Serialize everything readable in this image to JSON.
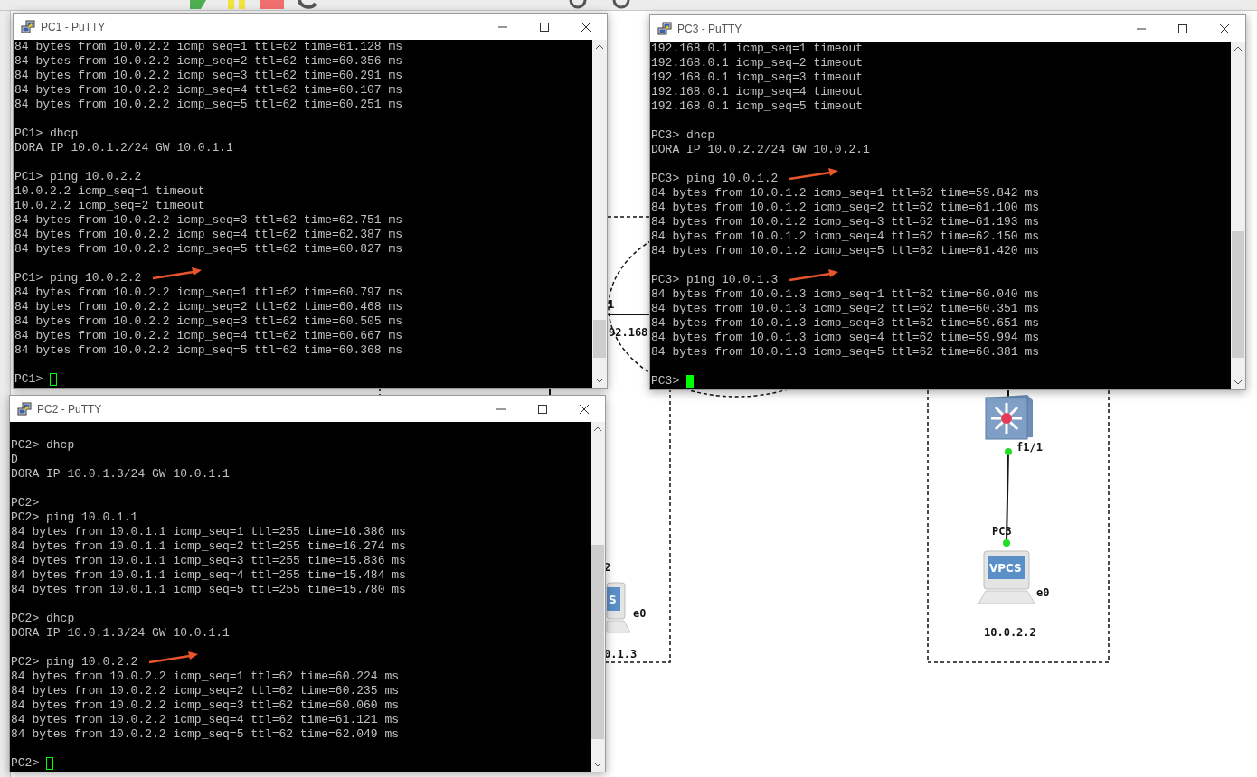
{
  "canvas": {
    "link_port": "1",
    "link_network": "92.168",
    "left_node_label": "2",
    "left_screen": "S",
    "left_port": "e0",
    "left_address": "0.1.3",
    "switch_port": "f1/1",
    "pc3_name": "PC3",
    "pc3_screen": "VPCS",
    "pc3_port": "e0",
    "pc3_address": "10.0.2.2"
  },
  "windows": [
    {
      "title": "PC1 - PuTTY",
      "prompt": "PC1>",
      "cursor_filled": false,
      "blocks": [
        {
          "arrow": false,
          "lines": [
            "84 bytes from 10.0.2.2 icmp_seq=1 ttl=62 time=61.128 ms",
            "84 bytes from 10.0.2.2 icmp_seq=2 ttl=62 time=60.356 ms",
            "84 bytes from 10.0.2.2 icmp_seq=3 ttl=62 time=60.291 ms",
            "84 bytes from 10.0.2.2 icmp_seq=4 ttl=62 time=60.107 ms",
            "84 bytes from 10.0.2.2 icmp_seq=5 ttl=62 time=60.251 ms"
          ]
        },
        {
          "arrow": false,
          "lines": [
            "PC1> dhcp",
            "DORA IP 10.0.1.2/24 GW 10.0.1.1"
          ]
        },
        {
          "arrow": false,
          "lines": [
            "PC1> ping 10.0.2.2",
            "10.0.2.2 icmp_seq=1 timeout",
            "10.0.2.2 icmp_seq=2 timeout",
            "84 bytes from 10.0.2.2 icmp_seq=3 ttl=62 time=62.751 ms",
            "84 bytes from 10.0.2.2 icmp_seq=4 ttl=62 time=62.387 ms",
            "84 bytes from 10.0.2.2 icmp_seq=5 ttl=62 time=60.827 ms"
          ]
        },
        {
          "arrow": true,
          "lines": [
            "PC1> ping 10.0.2.2",
            "84 bytes from 10.0.2.2 icmp_seq=1 ttl=62 time=60.797 ms",
            "84 bytes from 10.0.2.2 icmp_seq=2 ttl=62 time=60.468 ms",
            "84 bytes from 10.0.2.2 icmp_seq=3 ttl=62 time=60.505 ms",
            "84 bytes from 10.0.2.2 icmp_seq=4 ttl=62 time=60.667 ms",
            "84 bytes from 10.0.2.2 icmp_seq=5 ttl=62 time=60.368 ms"
          ]
        }
      ]
    },
    {
      "title": "PC3 - PuTTY",
      "prompt": "PC3>",
      "cursor_filled": true,
      "blocks": [
        {
          "arrow": false,
          "lines": [
            "192.168.0.1 icmp_seq=1 timeout",
            "192.168.0.1 icmp_seq=2 timeout",
            "192.168.0.1 icmp_seq=3 timeout",
            "192.168.0.1 icmp_seq=4 timeout",
            "192.168.0.1 icmp_seq=5 timeout"
          ]
        },
        {
          "arrow": false,
          "lines": [
            "PC3> dhcp",
            "DORA IP 10.0.2.2/24 GW 10.0.2.1"
          ]
        },
        {
          "arrow": true,
          "lines": [
            "PC3> ping 10.0.1.2",
            "84 bytes from 10.0.1.2 icmp_seq=1 ttl=62 time=59.842 ms",
            "84 bytes from 10.0.1.2 icmp_seq=2 ttl=62 time=61.100 ms",
            "84 bytes from 10.0.1.2 icmp_seq=3 ttl=62 time=61.193 ms",
            "84 bytes from 10.0.1.2 icmp_seq=4 ttl=62 time=62.150 ms",
            "84 bytes from 10.0.1.2 icmp_seq=5 ttl=62 time=61.420 ms"
          ]
        },
        {
          "arrow": true,
          "lines": [
            "PC3> ping 10.0.1.3",
            "84 bytes from 10.0.1.3 icmp_seq=1 ttl=62 time=60.040 ms",
            "84 bytes from 10.0.1.3 icmp_seq=2 ttl=62 time=60.351 ms",
            "84 bytes from 10.0.1.3 icmp_seq=3 ttl=62 time=59.651 ms",
            "84 bytes from 10.0.1.3 icmp_seq=4 ttl=62 time=59.994 ms",
            "84 bytes from 10.0.1.3 icmp_seq=5 ttl=62 time=60.381 ms"
          ]
        }
      ]
    },
    {
      "title": "PC2 - PuTTY",
      "prompt": "PC2>",
      "cursor_filled": false,
      "blocks": [
        {
          "arrow": false,
          "lines": [
            "PC2> dhcp",
            "D",
            "DORA IP 10.0.1.3/24 GW 10.0.1.1"
          ]
        },
        {
          "arrow": false,
          "lines": [
            "PC2>",
            "PC2> ping 10.0.1.1",
            "84 bytes from 10.0.1.1 icmp_seq=1 ttl=255 time=16.386 ms",
            "84 bytes from 10.0.1.1 icmp_seq=2 ttl=255 time=16.274 ms",
            "84 bytes from 10.0.1.1 icmp_seq=3 ttl=255 time=15.836 ms",
            "84 bytes from 10.0.1.1 icmp_seq=4 ttl=255 time=15.484 ms",
            "84 bytes from 10.0.1.1 icmp_seq=5 ttl=255 time=15.780 ms"
          ]
        },
        {
          "arrow": false,
          "lines": [
            "PC2> dhcp",
            "DORA IP 10.0.1.3/24 GW 10.0.1.1"
          ]
        },
        {
          "arrow": true,
          "lines": [
            "PC2> ping 10.0.2.2",
            "84 bytes from 10.0.2.2 icmp_seq=1 ttl=62 time=60.224 ms",
            "84 bytes from 10.0.2.2 icmp_seq=2 ttl=62 time=60.235 ms",
            "84 bytes from 10.0.2.2 icmp_seq=3 ttl=62 time=60.060 ms",
            "84 bytes from 10.0.2.2 icmp_seq=4 ttl=62 time=61.121 ms",
            "84 bytes from 10.0.2.2 icmp_seq=5 ttl=62 time=62.049 ms"
          ]
        }
      ]
    }
  ]
}
